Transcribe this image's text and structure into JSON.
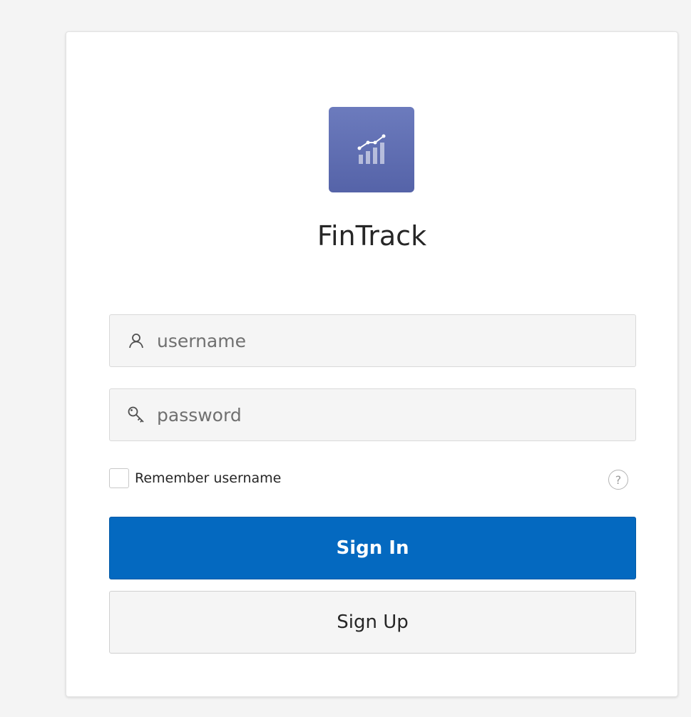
{
  "app": {
    "title": "FinTrack",
    "logo_icon": "chart-bars-icon",
    "logo_color": "#5f6db3"
  },
  "login": {
    "username": {
      "placeholder": "username",
      "value": "",
      "icon": "user-icon"
    },
    "password": {
      "placeholder": "password",
      "value": "",
      "icon": "key-icon"
    },
    "remember_label": "Remember username",
    "remember_checked": false,
    "help_icon": "help-icon",
    "help_glyph": "?",
    "sign_in_label": "Sign In",
    "sign_up_label": "Sign Up",
    "primary_color": "#0469c0"
  }
}
